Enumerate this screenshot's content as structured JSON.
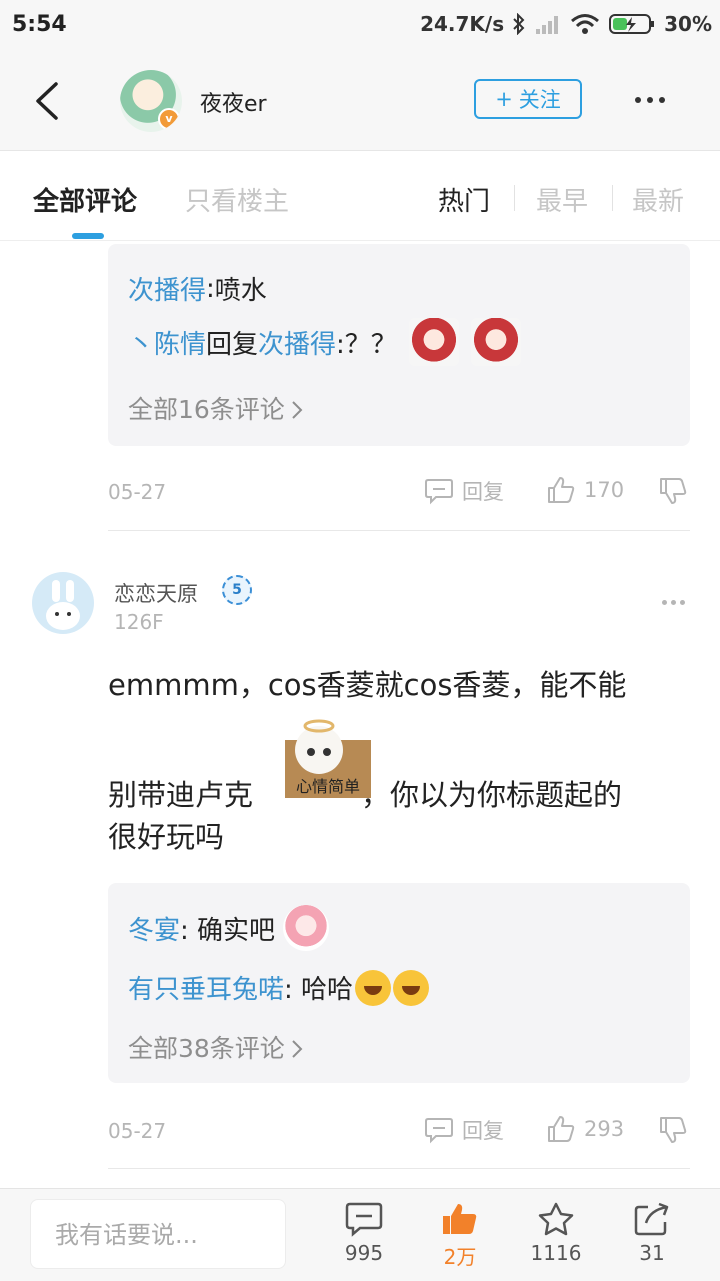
{
  "status_bar": {
    "time": "5:54",
    "speed": "24.7K/s",
    "battery": "30%"
  },
  "header": {
    "username": "夜夜er",
    "follow_label": "关注",
    "follow_plus": "+"
  },
  "tabs": {
    "all": "全部评论",
    "host_only": "只看楼主",
    "sort_hot": "热门",
    "sort_early": "最早",
    "sort_new": "最新"
  },
  "comment1_replies": {
    "r1_user": "次播得",
    "r1_sep": ": ",
    "r1_text": "喷水",
    "r2_user": "丶陈情",
    "r2_action": "回复 ",
    "r2_target": "次播得",
    "r2_text": ":？？",
    "see_all": "全部16条评论"
  },
  "comment1_meta": {
    "date": "05-27",
    "reply_label": "回复",
    "likes": "170"
  },
  "comment2": {
    "username": "恋恋天原",
    "level": "5",
    "floor": "126F",
    "text_line1": "emmmm，cos香菱就cos香菱，能不能",
    "text_line2a": "别带迪卢克",
    "text_line2b": "，你以为你标题起的",
    "text_line3": "很好玩吗",
    "sticker_text": "心情简单"
  },
  "comment2_replies": {
    "r1_user": "冬宴",
    "r1_text": ": 确实吧",
    "r2_user": "有只垂耳兔喏",
    "r2_text": ": 哈哈",
    "see_all": "全部38条评论"
  },
  "comment2_meta": {
    "date": "05-27",
    "reply_label": "回复",
    "likes": "293"
  },
  "bottom_bar": {
    "input_placeholder": "我有话要说...",
    "comments": "995",
    "likes": "2万",
    "favorites": "1116",
    "shares": "31"
  },
  "colors": {
    "accent": "#2d9fe0",
    "link": "#3d93cf",
    "like_active": "#f2812a"
  }
}
